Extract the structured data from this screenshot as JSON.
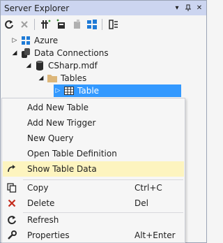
{
  "window": {
    "title": "Server Explorer"
  },
  "tree": {
    "azure": "Azure",
    "data_connections": "Data Connections",
    "db": "CSharp.mdf",
    "tables": "Tables",
    "table": "Table"
  },
  "menu": {
    "items": [
      {
        "label": "Add New Table",
        "shortcut": ""
      },
      {
        "label": "Add New Trigger",
        "shortcut": ""
      },
      {
        "label": "New Query",
        "shortcut": ""
      },
      {
        "label": "Open Table Definition",
        "shortcut": ""
      },
      {
        "label": "Show Table Data",
        "shortcut": ""
      },
      {
        "label": "Copy",
        "shortcut": "Ctrl+C"
      },
      {
        "label": "Delete",
        "shortcut": "Del"
      },
      {
        "label": "Refresh",
        "shortcut": ""
      },
      {
        "label": "Properties",
        "shortcut": "Alt+Enter"
      }
    ]
  },
  "colors": {
    "titlebar": "#ccd5f0",
    "selection": "#3399ff",
    "menu_highlight": "#fdf4bf",
    "delete_icon": "#c42b1c"
  }
}
